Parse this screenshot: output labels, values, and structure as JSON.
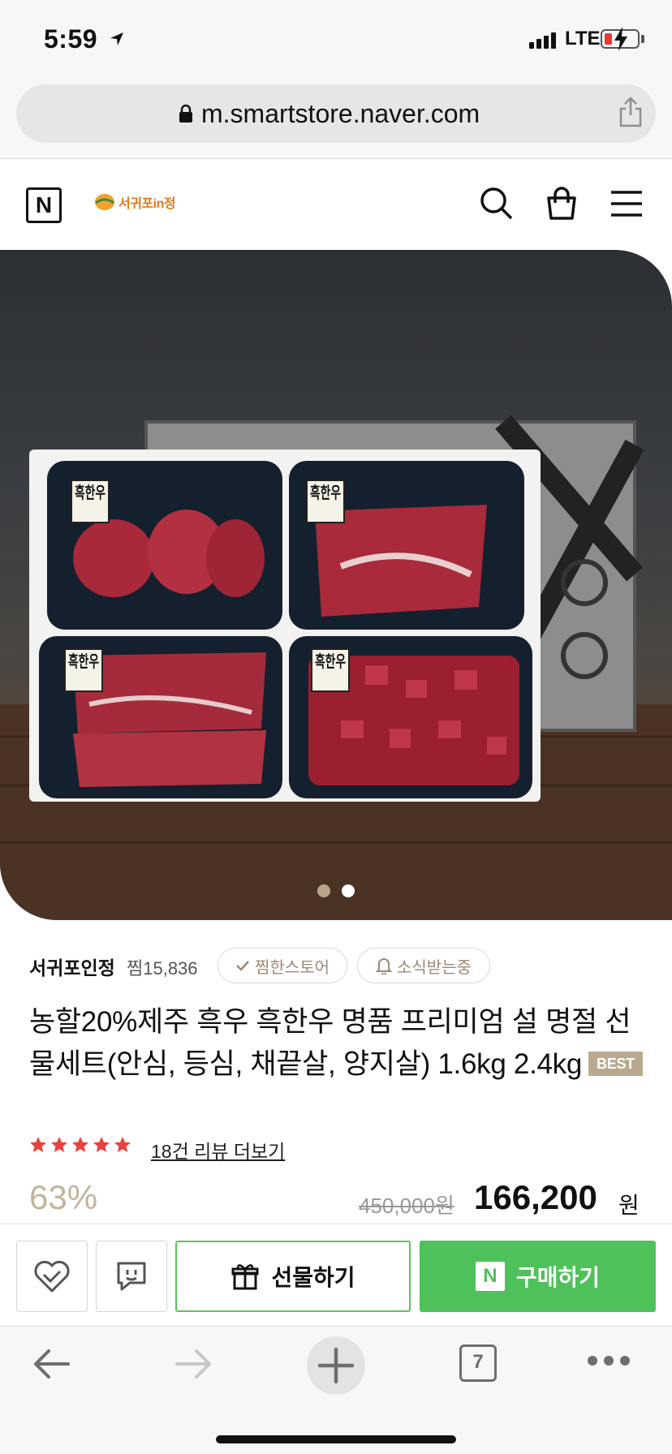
{
  "status_bar": {
    "time": "5:59",
    "network": "LTE"
  },
  "browser": {
    "url": "m.smartstore.naver.com",
    "tab_count": "7"
  },
  "store_header": {
    "naver_logo": "N",
    "brand_logo_text": "서귀포in정"
  },
  "carousel": {
    "total_slides": 2,
    "active_slide": 2
  },
  "store": {
    "name": "서귀포인정",
    "zzim_count": "찜15,836",
    "zzim_button": "찜한스토어",
    "notify_button": "소식받는중"
  },
  "product": {
    "title": "농할20%제주 흑우 흑한우 명품 프리미엄 설 명절 선물세트(안심, 등심, 채끝살, 양지살) 1.6kg 2.4kg",
    "badge": "BEST",
    "rating_stars": 5,
    "review_link": "18건 리뷰 더보기",
    "discount": "63%",
    "original_price": "450,000원",
    "sale_price": "166,200",
    "currency": "원",
    "tray_label": "흑한우"
  },
  "actions": {
    "gift_label": "선물하기",
    "buy_label": "구매하기",
    "buy_icon_text": "N"
  },
  "colors": {
    "naver_green": "#4fc15a",
    "accent_beige": "#c3b39b",
    "star_red": "#e8433f",
    "brand_orange": "#e07b1b"
  },
  "icons": [
    "location-arrow-icon",
    "lock-icon",
    "share-icon",
    "search-icon",
    "shopping-bag-icon",
    "hamburger-menu-icon",
    "check-icon",
    "bell-icon",
    "heart-icon",
    "chat-icon",
    "gift-icon",
    "back-arrow-icon",
    "forward-arrow-icon",
    "plus-icon",
    "more-dots-icon"
  ]
}
